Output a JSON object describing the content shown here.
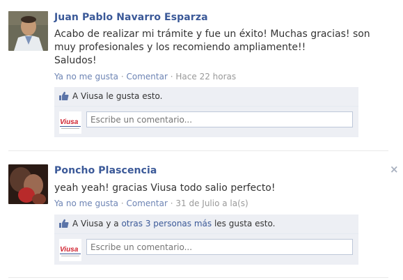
{
  "posts": [
    {
      "author": "Juan Pablo Navarro Esparza",
      "body": "Acabo de realizar mi trámite y fue un éxito! Muchas gracias! son\nmuy profesionales y los recomiendo ampliamente!!\nSaludos!",
      "unlike": "Ya no me gusta",
      "comment": "Comentar",
      "sep": "·",
      "timestamp": "Hace 22 horas",
      "likes_text": "A Viusa le gusta esto.",
      "comment_placeholder": "Escribe un comentario..."
    },
    {
      "author": "Poncho Plascencia",
      "body": "yeah yeah! gracias Viusa todo salio perfecto!",
      "unlike": "Ya no me gusta",
      "comment": "Comentar",
      "sep": "·",
      "timestamp": "31 de Julio a la(s)",
      "likes_prefix": "A Viusa y a",
      "likes_link": "otras 3 personas más",
      "likes_suffix": "les gusta esto.",
      "comment_placeholder": "Escribe un comentario..."
    }
  ],
  "close_label": "×",
  "logo_text": "Viusa",
  "colors": {
    "link": "#3b5998",
    "meta_link": "#6d84b4",
    "ufi_bg": "#edeff4",
    "logo_red": "#d0202e"
  },
  "icons": [
    "thumbs-up-icon",
    "close-icon",
    "viusa-logo"
  ]
}
